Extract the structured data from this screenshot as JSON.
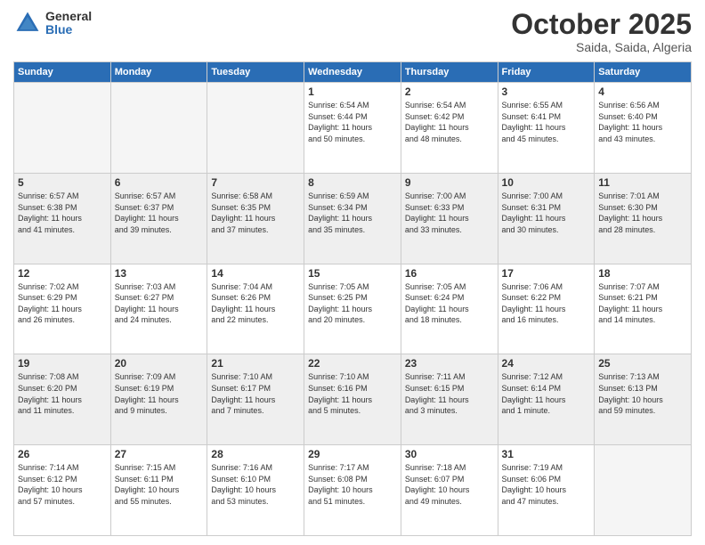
{
  "header": {
    "logo_general": "General",
    "logo_blue": "Blue",
    "month_title": "October 2025",
    "location": "Saida, Saida, Algeria"
  },
  "weekdays": [
    "Sunday",
    "Monday",
    "Tuesday",
    "Wednesday",
    "Thursday",
    "Friday",
    "Saturday"
  ],
  "weeks": [
    [
      {
        "day": "",
        "info": ""
      },
      {
        "day": "",
        "info": ""
      },
      {
        "day": "",
        "info": ""
      },
      {
        "day": "1",
        "info": "Sunrise: 6:54 AM\nSunset: 6:44 PM\nDaylight: 11 hours\nand 50 minutes."
      },
      {
        "day": "2",
        "info": "Sunrise: 6:54 AM\nSunset: 6:42 PM\nDaylight: 11 hours\nand 48 minutes."
      },
      {
        "day": "3",
        "info": "Sunrise: 6:55 AM\nSunset: 6:41 PM\nDaylight: 11 hours\nand 45 minutes."
      },
      {
        "day": "4",
        "info": "Sunrise: 6:56 AM\nSunset: 6:40 PM\nDaylight: 11 hours\nand 43 minutes."
      }
    ],
    [
      {
        "day": "5",
        "info": "Sunrise: 6:57 AM\nSunset: 6:38 PM\nDaylight: 11 hours\nand 41 minutes."
      },
      {
        "day": "6",
        "info": "Sunrise: 6:57 AM\nSunset: 6:37 PM\nDaylight: 11 hours\nand 39 minutes."
      },
      {
        "day": "7",
        "info": "Sunrise: 6:58 AM\nSunset: 6:35 PM\nDaylight: 11 hours\nand 37 minutes."
      },
      {
        "day": "8",
        "info": "Sunrise: 6:59 AM\nSunset: 6:34 PM\nDaylight: 11 hours\nand 35 minutes."
      },
      {
        "day": "9",
        "info": "Sunrise: 7:00 AM\nSunset: 6:33 PM\nDaylight: 11 hours\nand 33 minutes."
      },
      {
        "day": "10",
        "info": "Sunrise: 7:00 AM\nSunset: 6:31 PM\nDaylight: 11 hours\nand 30 minutes."
      },
      {
        "day": "11",
        "info": "Sunrise: 7:01 AM\nSunset: 6:30 PM\nDaylight: 11 hours\nand 28 minutes."
      }
    ],
    [
      {
        "day": "12",
        "info": "Sunrise: 7:02 AM\nSunset: 6:29 PM\nDaylight: 11 hours\nand 26 minutes."
      },
      {
        "day": "13",
        "info": "Sunrise: 7:03 AM\nSunset: 6:27 PM\nDaylight: 11 hours\nand 24 minutes."
      },
      {
        "day": "14",
        "info": "Sunrise: 7:04 AM\nSunset: 6:26 PM\nDaylight: 11 hours\nand 22 minutes."
      },
      {
        "day": "15",
        "info": "Sunrise: 7:05 AM\nSunset: 6:25 PM\nDaylight: 11 hours\nand 20 minutes."
      },
      {
        "day": "16",
        "info": "Sunrise: 7:05 AM\nSunset: 6:24 PM\nDaylight: 11 hours\nand 18 minutes."
      },
      {
        "day": "17",
        "info": "Sunrise: 7:06 AM\nSunset: 6:22 PM\nDaylight: 11 hours\nand 16 minutes."
      },
      {
        "day": "18",
        "info": "Sunrise: 7:07 AM\nSunset: 6:21 PM\nDaylight: 11 hours\nand 14 minutes."
      }
    ],
    [
      {
        "day": "19",
        "info": "Sunrise: 7:08 AM\nSunset: 6:20 PM\nDaylight: 11 hours\nand 11 minutes."
      },
      {
        "day": "20",
        "info": "Sunrise: 7:09 AM\nSunset: 6:19 PM\nDaylight: 11 hours\nand 9 minutes."
      },
      {
        "day": "21",
        "info": "Sunrise: 7:10 AM\nSunset: 6:17 PM\nDaylight: 11 hours\nand 7 minutes."
      },
      {
        "day": "22",
        "info": "Sunrise: 7:10 AM\nSunset: 6:16 PM\nDaylight: 11 hours\nand 5 minutes."
      },
      {
        "day": "23",
        "info": "Sunrise: 7:11 AM\nSunset: 6:15 PM\nDaylight: 11 hours\nand 3 minutes."
      },
      {
        "day": "24",
        "info": "Sunrise: 7:12 AM\nSunset: 6:14 PM\nDaylight: 11 hours\nand 1 minute."
      },
      {
        "day": "25",
        "info": "Sunrise: 7:13 AM\nSunset: 6:13 PM\nDaylight: 10 hours\nand 59 minutes."
      }
    ],
    [
      {
        "day": "26",
        "info": "Sunrise: 7:14 AM\nSunset: 6:12 PM\nDaylight: 10 hours\nand 57 minutes."
      },
      {
        "day": "27",
        "info": "Sunrise: 7:15 AM\nSunset: 6:11 PM\nDaylight: 10 hours\nand 55 minutes."
      },
      {
        "day": "28",
        "info": "Sunrise: 7:16 AM\nSunset: 6:10 PM\nDaylight: 10 hours\nand 53 minutes."
      },
      {
        "day": "29",
        "info": "Sunrise: 7:17 AM\nSunset: 6:08 PM\nDaylight: 10 hours\nand 51 minutes."
      },
      {
        "day": "30",
        "info": "Sunrise: 7:18 AM\nSunset: 6:07 PM\nDaylight: 10 hours\nand 49 minutes."
      },
      {
        "day": "31",
        "info": "Sunrise: 7:19 AM\nSunset: 6:06 PM\nDaylight: 10 hours\nand 47 minutes."
      },
      {
        "day": "",
        "info": ""
      }
    ]
  ]
}
